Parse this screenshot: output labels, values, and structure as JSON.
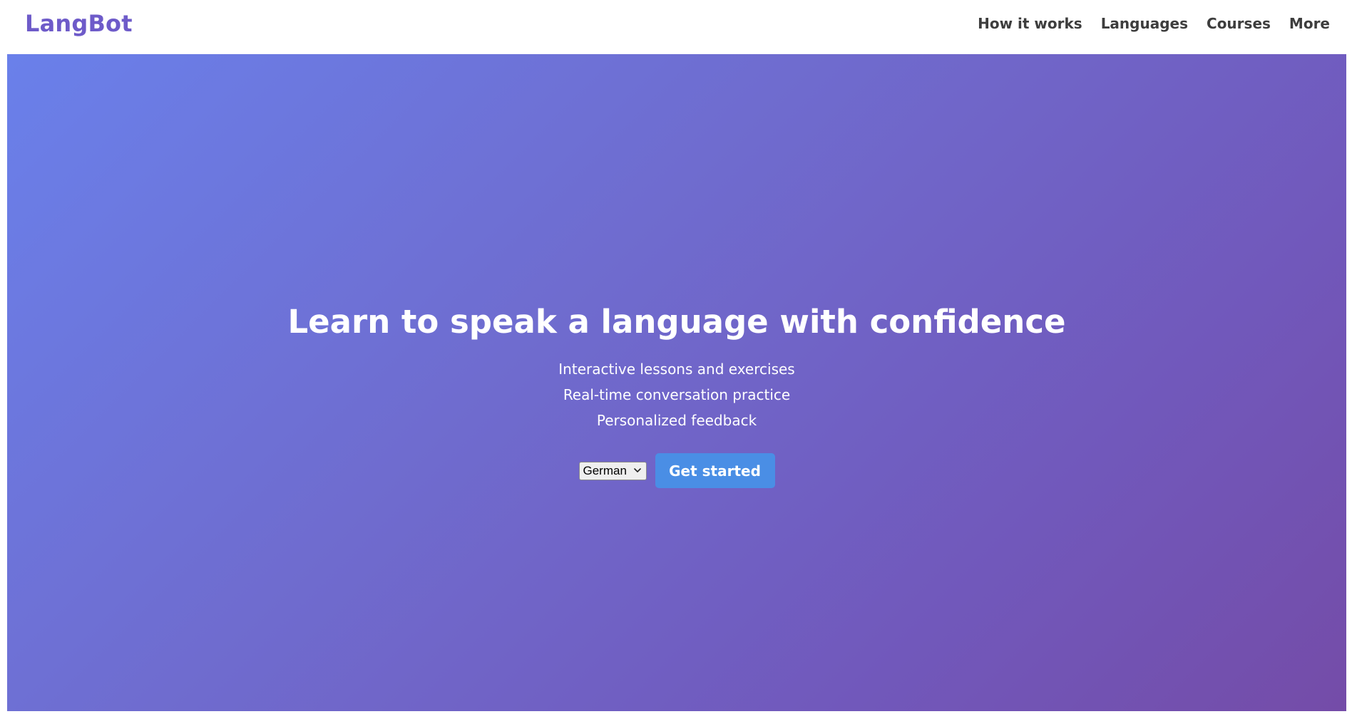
{
  "brand": {
    "name": "LangBot",
    "color": "#6e5bc9"
  },
  "nav": {
    "items": [
      {
        "label": "How it works"
      },
      {
        "label": "Languages"
      },
      {
        "label": "Courses"
      },
      {
        "label": "More"
      }
    ]
  },
  "hero": {
    "title": "Learn to speak a language with confidence",
    "features": [
      "Interactive lessons and exercises",
      "Real-time conversation practice",
      "Personalized feedback"
    ],
    "language_select": {
      "selected": "German"
    },
    "cta_label": "Get started",
    "cta_color": "#4a8ee5",
    "gradient": [
      "#6a80ea",
      "#744ca8"
    ]
  }
}
